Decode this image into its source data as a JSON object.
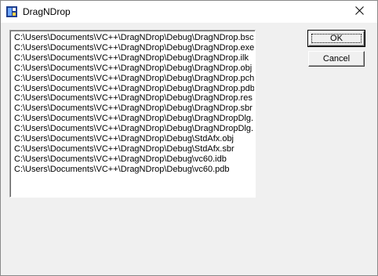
{
  "window": {
    "title": "DragNDrop"
  },
  "buttons": {
    "ok_label": "OK",
    "cancel_label": "Cancel"
  },
  "list": {
    "items": [
      "C:\\Users\\Documents\\VC++\\DragNDrop\\Debug\\DragNDrop.bsc",
      "C:\\Users\\Documents\\VC++\\DragNDrop\\Debug\\DragNDrop.exe",
      "C:\\Users\\Documents\\VC++\\DragNDrop\\Debug\\DragNDrop.ilk",
      "C:\\Users\\Documents\\VC++\\DragNDrop\\Debug\\DragNDrop.obj",
      "C:\\Users\\Documents\\VC++\\DragNDrop\\Debug\\DragNDrop.pch",
      "C:\\Users\\Documents\\VC++\\DragNDrop\\Debug\\DragNDrop.pdb",
      "C:\\Users\\Documents\\VC++\\DragNDrop\\Debug\\DragNDrop.res",
      "C:\\Users\\Documents\\VC++\\DragNDrop\\Debug\\DragNDrop.sbr",
      "C:\\Users\\Documents\\VC++\\DragNDrop\\Debug\\DragNDropDlg.",
      "C:\\Users\\Documents\\VC++\\DragNDrop\\Debug\\DragNDropDlg.",
      "C:\\Users\\Documents\\VC++\\DragNDrop\\Debug\\StdAfx.obj",
      "C:\\Users\\Documents\\VC++\\DragNDrop\\Debug\\StdAfx.sbr",
      "C:\\Users\\Documents\\VC++\\DragNDrop\\Debug\\vc60.idb",
      "C:\\Users\\Documents\\VC++\\DragNDrop\\Debug\\vc60.pdb"
    ]
  },
  "icons": {
    "app": "app-icon",
    "close": "close-icon"
  }
}
